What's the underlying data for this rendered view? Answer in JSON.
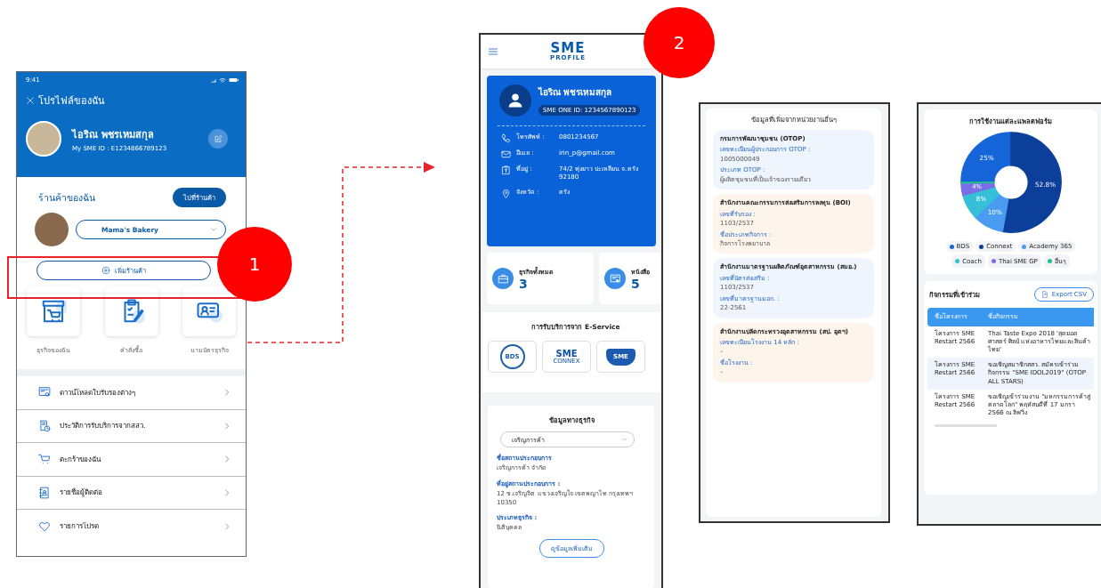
{
  "callouts": [
    {
      "label": "1"
    },
    {
      "label": "2"
    }
  ],
  "mobile_app": {
    "status_time": "9:41",
    "title": "โปรไฟล์ของฉัน",
    "user": {
      "name": "ไอริณ พชรเหมสกุล",
      "id": "My SME ID : E1234866789123"
    },
    "shop_heading": "ร้านค้าของฉัน",
    "shop_button": "ไปที่ร้านค้า",
    "shop_select": {
      "value": "Mama's Bakery"
    },
    "add_shop": "เพิ่มร้านค้า",
    "tiles": [
      {
        "label": "ธุรกิจของฉัน"
      },
      {
        "label": "คำสั่งซื้อ"
      },
      {
        "label": "นามบัตรธุรกิจ"
      }
    ],
    "menu": [
      {
        "label": "ดาวน์โหลดใบรับรองต่างๆ"
      },
      {
        "label": "ประวัติการรับบริการจากสสว."
      },
      {
        "label": "ตะกร้าของฉัน"
      },
      {
        "label": "รายชื่อผู้ติดต่อ"
      },
      {
        "label": "รายการโปรด"
      }
    ]
  },
  "web_profile": {
    "logo": {
      "top": "SME",
      "bottom": "PROFILE"
    },
    "user": {
      "name": "ไอริณ พชรเหมสกุล",
      "id": "SME ONE ID: 1234567890123"
    },
    "contacts": [
      {
        "label": "โทรศัพท์ :",
        "value": "0801234567"
      },
      {
        "label": "อีเมล :",
        "value": "irin_p@gmail.com"
      },
      {
        "label": "ที่อยู่ :",
        "value": "74/2 ทุ่งยาว ปะเหลียน จ.ตรัง 92180"
      },
      {
        "label": "จังหวัด :",
        "value": "ตรัง"
      }
    ],
    "stats": [
      {
        "label": "ธุรกิจทั้งหมด",
        "value": "3"
      },
      {
        "label": "หนังสือ",
        "value": "5"
      }
    ],
    "eservice": {
      "title": "การรับบริการจาก E-Service",
      "logos": [
        {
          "lines": [
            "BDS"
          ]
        },
        {
          "lines": [
            "SME",
            "CONNEX"
          ]
        },
        {
          "lines": [
            "SME"
          ]
        }
      ]
    },
    "business": {
      "title": "ข้อมูลทางธุรกิจ",
      "select": {
        "value": "เจริญการค้า"
      },
      "fields": [
        {
          "label": "ชื่อสถานประกอบการ",
          "value": "เจริญการค้า จำกัด"
        },
        {
          "label": "ที่อยู่สถานประกอบการ :",
          "value": "12 ซ.เจริญจิต แขวงเจริญใจ เขตพญาไท กรุงเทพฯ 10350"
        },
        {
          "label": "ประเภทธุรกิจ :",
          "value": "นิติบุคคล"
        }
      ],
      "more_button": "ดูข้อมูลเพิ่มเติม"
    }
  },
  "agency_data": {
    "title": "ข้อมูลที่เพิ่มจากหน่วยงานอื่นๆ",
    "agencies": [
      {
        "color": "#eef5fd",
        "name": "กรมการพัฒนาชุมชน (OTOP)",
        "fields": [
          {
            "label": "เลขทะเบียนผู้ประกอบการ OTOP :",
            "value": "1005000049"
          },
          {
            "label": "ประเภท OTOP :",
            "value": "ผู้ผลิตชุมชนที่เป็นเจ้าของรายเดียว"
          }
        ]
      },
      {
        "color": "#fdf5ec",
        "name": "สำนักงานคณะกรรมการส่งเสริมการลงทุน (BOI)",
        "fields": [
          {
            "label": "เลขที่รับรอง :",
            "value": "1103/2537"
          },
          {
            "label": "ชื่อประเภทกิจการ :",
            "value": "กิจการโรงพยาบาล"
          }
        ]
      },
      {
        "color": "#eef5fd",
        "name": "สำนักงานมาตรฐานผลิตภัณฑ์อุตสาหกรรม (สมอ.)",
        "fields": [
          {
            "label": "เลขที่บัตรส่งเสริม :",
            "value": "1103/2537"
          },
          {
            "label": "เลขที่มาตรฐานมอก. :",
            "value": "22-2561"
          }
        ]
      },
      {
        "color": "#fdf5ec",
        "name": "สำนักงานปลัดกระทรวงอุตสาหกรรม (สป. อุตฯ)",
        "fields": [
          {
            "label": "เลขทะเบียนโรงงาน 14 หลัก :",
            "value": "–"
          },
          {
            "label": "ชื่อโรงงาน :",
            "value": "–"
          }
        ]
      }
    ]
  },
  "dashboard": {
    "platform_usage": {
      "chart_data": {
        "type": "donut",
        "title": "การใช้งานแต่ละแพลตฟอร์ม",
        "categories": [
          "BDS",
          "Connext",
          "Academy 365",
          "Coach",
          "Thai SME GP",
          "อื่นๆ"
        ],
        "values": [
          25,
          52.8,
          10,
          8,
          4,
          0.2
        ],
        "value_labels": [
          "25%",
          "52.8%",
          "10%",
          "8%",
          "4%",
          null
        ],
        "legend": "bottom"
      },
      "legend": [
        {
          "color": "#1565d8"
        },
        {
          "color": "#0b3f9a"
        },
        {
          "color": "#4a9cf0"
        },
        {
          "color": "#35c0d8"
        },
        {
          "color": "#7a6ee8"
        },
        {
          "color": "#22c08a"
        }
      ]
    },
    "activities": {
      "title": "กิจกรรมที่เข้าร่วม",
      "export_button": "Export CSV",
      "columns": [
        "ชื่อโครงการ",
        "ชื่อกิจกรรม"
      ],
      "rows": [
        {
          "cells": [
            "โครงการ SME Restart 2566",
            "Thai Taste Expo 2018 'สุดยอดศาสตร์ ศิลป์ แห่งอาหารไทยและสินค้าไทย'"
          ]
        },
        {
          "cells": [
            "โครงการ SME Restart 2566",
            "ขอเชิญสมาชิกสสว. สมัครเข้าร่วมกิจกรรม \"SME IDOL2019\" (OTOP ALL STARS)"
          ]
        },
        {
          "cells": [
            "โครงการ SME Restart 2566",
            "ขอเชิญเข้าร่วมงาน \"มหกรรมการค้าสู่ตลาดโลก\" พฤหัสบดีที่ 17 มกรา 2566 ณ ลิฟวิ่ง"
          ]
        }
      ]
    }
  }
}
